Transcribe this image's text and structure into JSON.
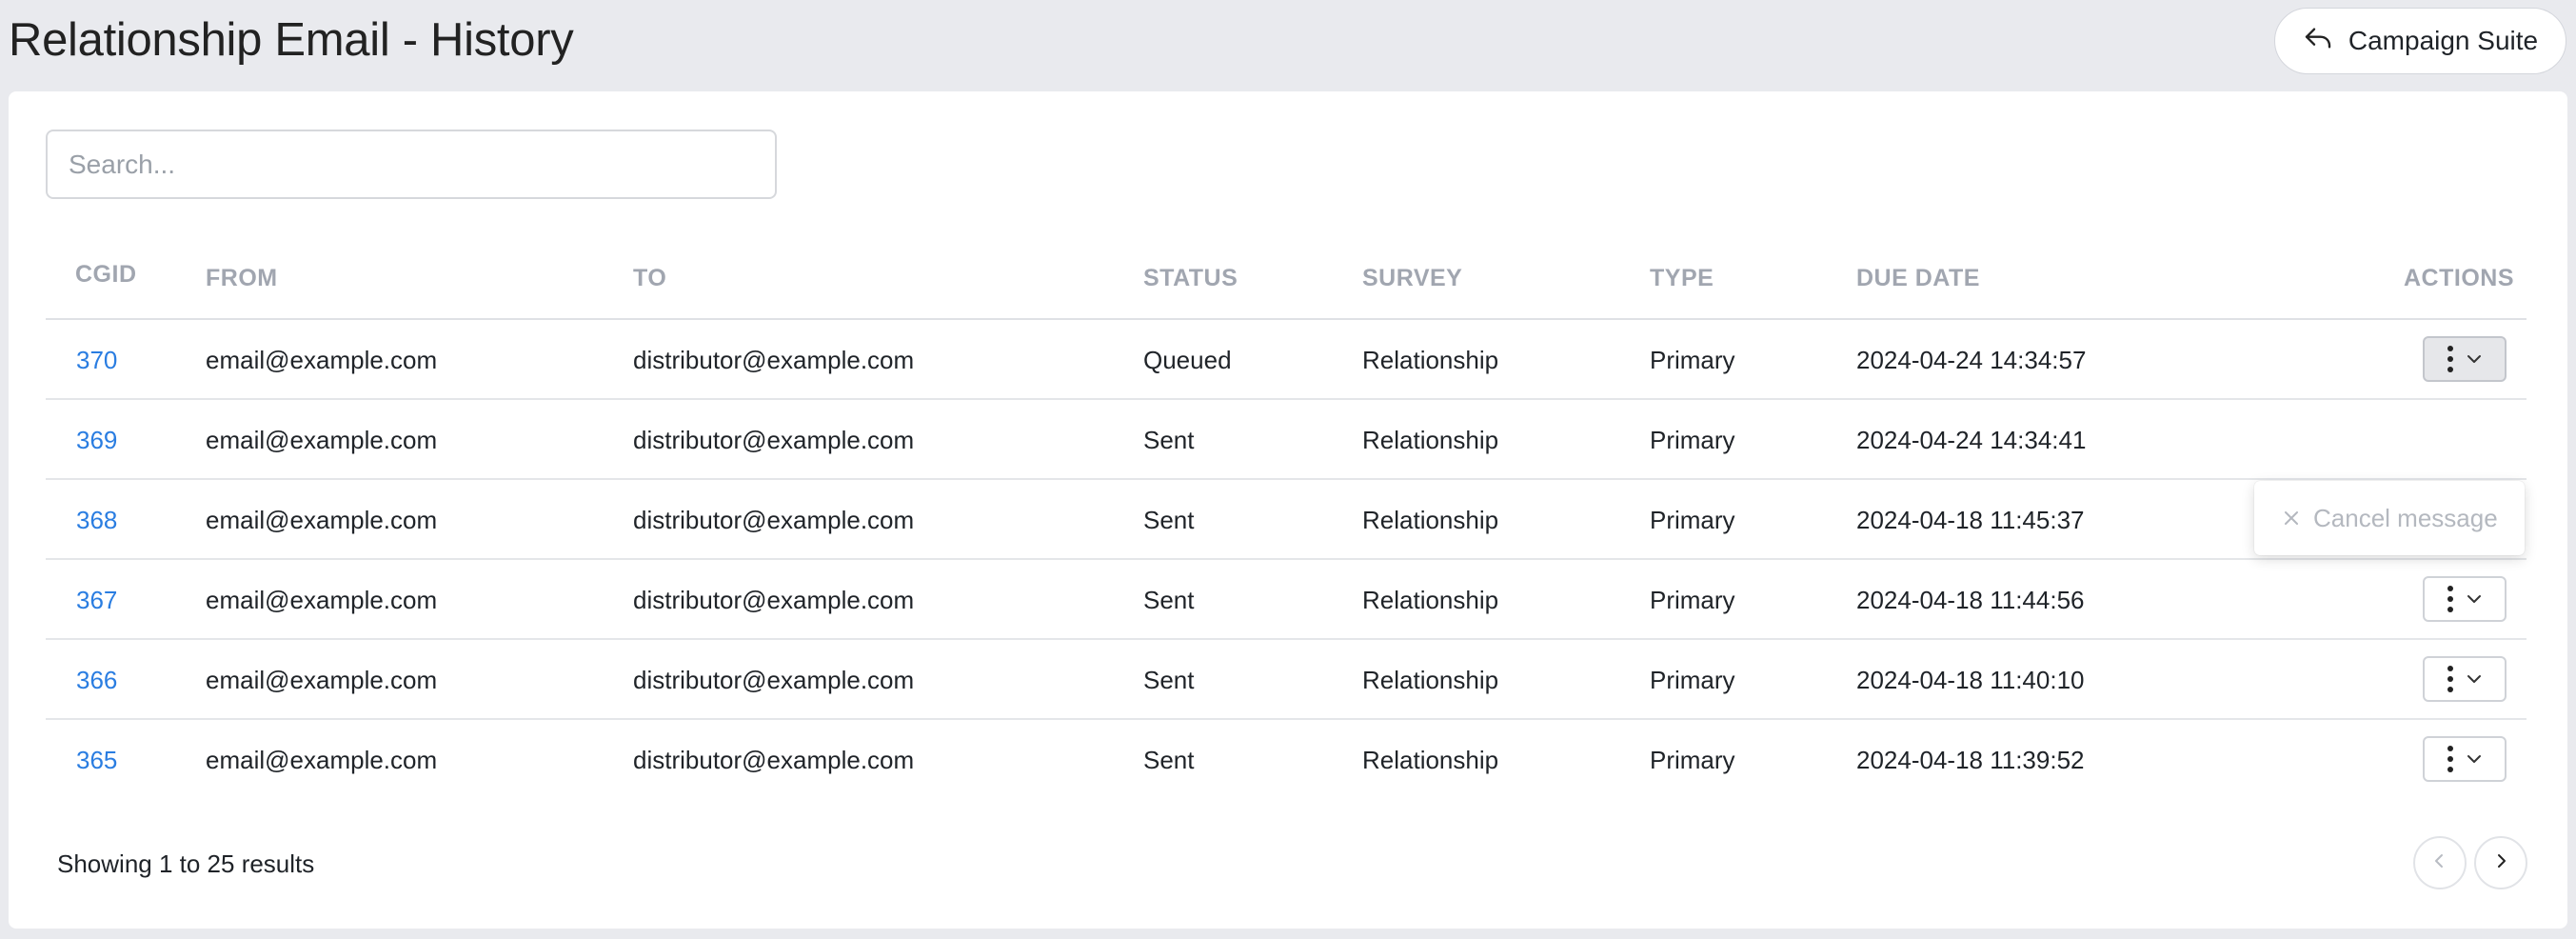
{
  "header": {
    "title": "Relationship Email - History",
    "back_button_label": "Campaign Suite"
  },
  "search": {
    "placeholder": "Search...",
    "value": ""
  },
  "table": {
    "columns": {
      "cgid": "CGID",
      "from": "FROM",
      "to": "TO",
      "status": "STATUS",
      "survey": "SURVEY",
      "type": "TYPE",
      "due_date": "DUE DATE",
      "actions": "ACTIONS"
    },
    "rows": [
      {
        "cgid": "370",
        "from": "email@example.com",
        "to": "distributor@example.com",
        "status": "Queued",
        "survey": "Relationship",
        "type": "Primary",
        "due_date": "2024-04-24 14:34:57"
      },
      {
        "cgid": "369",
        "from": "email@example.com",
        "to": "distributor@example.com",
        "status": "Sent",
        "survey": "Relationship",
        "type": "Primary",
        "due_date": "2024-04-24 14:34:41"
      },
      {
        "cgid": "368",
        "from": "email@example.com",
        "to": "distributor@example.com",
        "status": "Sent",
        "survey": "Relationship",
        "type": "Primary",
        "due_date": "2024-04-18 11:45:37"
      },
      {
        "cgid": "367",
        "from": "email@example.com",
        "to": "distributor@example.com",
        "status": "Sent",
        "survey": "Relationship",
        "type": "Primary",
        "due_date": "2024-04-18 11:44:56"
      },
      {
        "cgid": "366",
        "from": "email@example.com",
        "to": "distributor@example.com",
        "status": "Sent",
        "survey": "Relationship",
        "type": "Primary",
        "due_date": "2024-04-18 11:40:10"
      },
      {
        "cgid": "365",
        "from": "email@example.com",
        "to": "distributor@example.com",
        "status": "Sent",
        "survey": "Relationship",
        "type": "Primary",
        "due_date": "2024-04-18 11:39:52"
      }
    ]
  },
  "actions_menu": {
    "open_row": "370",
    "items": [
      {
        "label": "Cancel message",
        "icon": "close-icon",
        "disabled": true
      }
    ]
  },
  "footer": {
    "results_text": "Showing 1 to 25 results"
  },
  "colors": {
    "link": "#2a7de1",
    "background": "#e9eaee",
    "header_text": "#a1a6b0"
  }
}
